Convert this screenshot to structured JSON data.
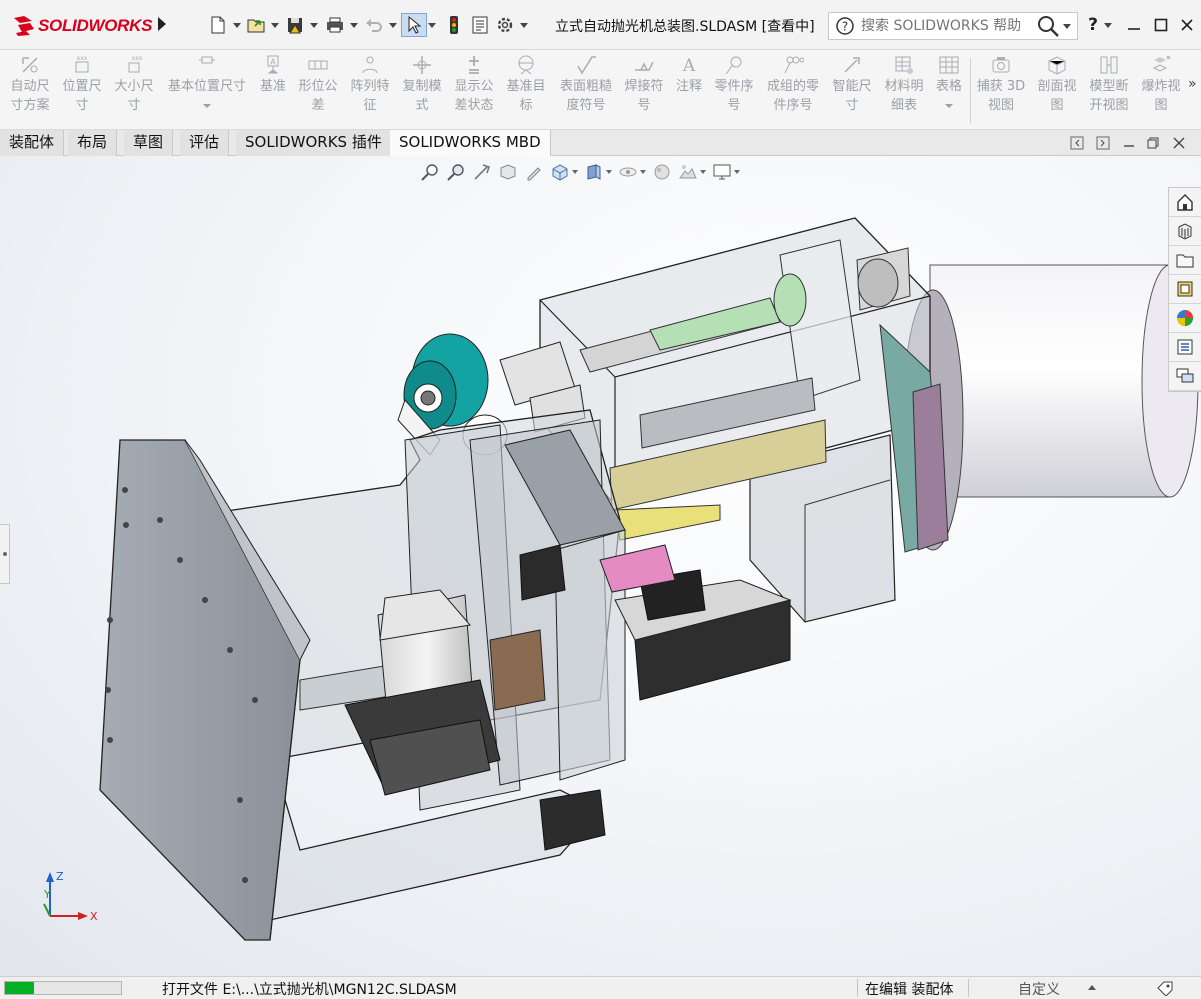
{
  "app": {
    "brand": "SOLIDWORKS",
    "document_title": "立式自动抛光机总装图.SLDASM [查看中]"
  },
  "quick_access": [
    {
      "name": "new-document",
      "icon": "new-document-icon"
    },
    {
      "name": "open",
      "icon": "open-folder-icon"
    },
    {
      "name": "save",
      "icon": "save-icon"
    },
    {
      "name": "print",
      "icon": "print-icon"
    },
    {
      "name": "undo",
      "icon": "undo-icon"
    },
    {
      "name": "select",
      "icon": "select-cursor-icon"
    },
    {
      "name": "rebuild",
      "icon": "traffic-light-icon"
    },
    {
      "name": "file-properties",
      "icon": "file-properties-icon"
    },
    {
      "name": "options",
      "icon": "gear-icon"
    }
  ],
  "search": {
    "placeholder": "搜索 SOLIDWORKS 帮助"
  },
  "window_controls": {
    "help": "?",
    "minimize": "minimize-icon",
    "maximize": "maximize-icon",
    "close": "close-icon"
  },
  "ribbon": {
    "buttons": [
      {
        "label": "自动尺\n寸方案",
        "icon": "auto-dimension-scheme-icon"
      },
      {
        "label": "位置尺\n寸",
        "icon": "location-dimension-icon"
      },
      {
        "label": "大小尺\n寸",
        "icon": "size-dimension-icon"
      },
      {
        "label": "基本位置尺寸",
        "icon": "basic-location-dimension-icon"
      },
      {
        "label": "基准",
        "icon": "datum-icon"
      },
      {
        "label": "形位公\n差",
        "icon": "geometric-tolerance-icon"
      },
      {
        "label": "阵列特\n征",
        "icon": "pattern-feature-icon"
      },
      {
        "label": "复制模\n式",
        "icon": "copy-scheme-icon"
      },
      {
        "label": "显示公\n差状态",
        "icon": "tolerance-status-icon"
      },
      {
        "label": "基准目\n标",
        "icon": "datum-target-icon"
      },
      {
        "label": "表面粗糙\n度符号",
        "icon": "surface-finish-icon"
      },
      {
        "label": "焊接符\n号",
        "icon": "weld-symbol-icon"
      },
      {
        "label": "注释",
        "icon": "note-icon"
      },
      {
        "label": "零件序\n号",
        "icon": "balloon-icon"
      },
      {
        "label": "成组的零\n件序号",
        "icon": "stacked-balloon-icon"
      },
      {
        "label": "智能尺\n寸",
        "icon": "smart-dimension-icon"
      },
      {
        "label": "材料明\n细表",
        "icon": "bill-of-materials-icon"
      },
      {
        "label": "表格",
        "icon": "table-icon"
      },
      {
        "label": "捕获 3D\n视图",
        "icon": "capture-3d-view-icon"
      },
      {
        "label": "剖面视\n图",
        "icon": "section-view-icon"
      },
      {
        "label": "模型断\n开视图",
        "icon": "model-break-view-icon"
      },
      {
        "label": "爆炸视\n图",
        "icon": "exploded-view-icon"
      }
    ],
    "more": "»"
  },
  "tabs": [
    {
      "label": "装配体",
      "active": false
    },
    {
      "label": "布局",
      "active": false
    },
    {
      "label": "草图",
      "active": false
    },
    {
      "label": "评估",
      "active": false
    },
    {
      "label": "SOLIDWORKS 插件",
      "active": false
    },
    {
      "label": "SOLIDWORKS MBD",
      "active": true
    }
  ],
  "view_toolbar": [
    "zoom-to-fit-icon",
    "zoom-to-area-icon",
    "previous-view-icon",
    "section-view-icon",
    "dynamic-annotation-icon",
    "view-orientation-icon",
    "display-style-icon",
    "hide-show-items-icon",
    "edit-appearance-icon",
    "apply-scene-icon",
    "view-settings-icon"
  ],
  "task_pane": [
    "solidworks-resources-icon",
    "design-library-icon",
    "file-explorer-icon",
    "view-palette-icon",
    "appearances-scenes-icon",
    "custom-properties-icon",
    "forum-icon"
  ],
  "triad": {
    "z": "Z",
    "y": "Y",
    "x": "X"
  },
  "status": {
    "progress": 0.25,
    "message": "打开文件  E:\\...\\立式抛光机\\MGN12C.SLDASM",
    "mode": "在编辑 装配体",
    "units": "自定义"
  }
}
